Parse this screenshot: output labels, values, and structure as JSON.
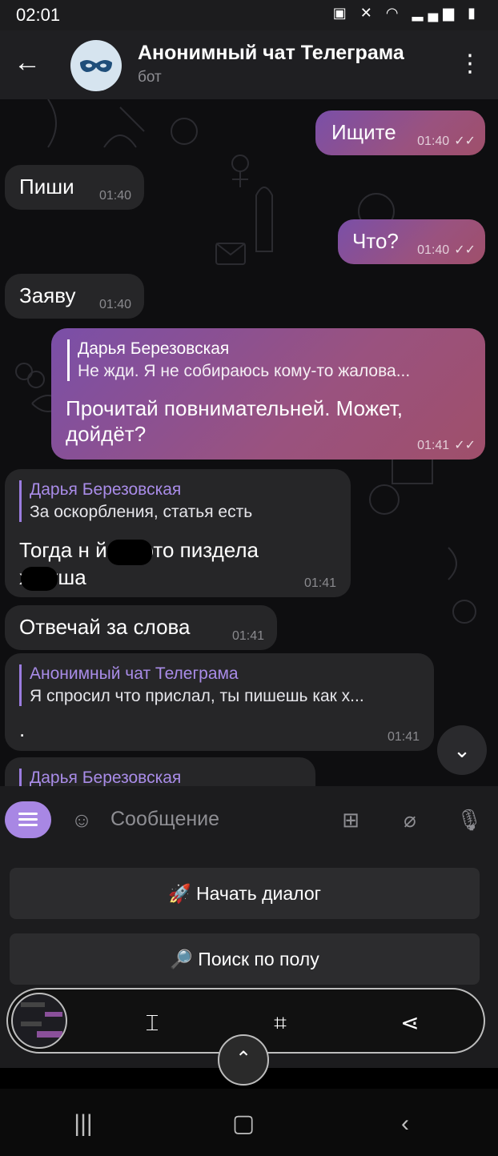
{
  "status_bar": {
    "time": "02:01",
    "icons": [
      "battery-saver-icon",
      "mute-icon",
      "wifi-icon",
      "signal-icon",
      "battery-icon"
    ]
  },
  "header": {
    "title": "Анонимный чат Телеграма",
    "subtitle": "бот",
    "avatar_icon": "mask-icon"
  },
  "messages": [
    {
      "direction": "out",
      "text": "Ищите",
      "time": "01:40",
      "read": true
    },
    {
      "direction": "in",
      "text": "Пиши",
      "time": "01:40"
    },
    {
      "direction": "out",
      "text": "Что?",
      "time": "01:40",
      "read": true
    },
    {
      "direction": "in",
      "text": "Заяву",
      "time": "01:40"
    },
    {
      "direction": "out",
      "reply": {
        "name": "Дарья Березовская",
        "text": "Не жди. Я не собираюсь кому-то жалова..."
      },
      "text_lines": [
        "Прочитай повнимательней. Может,",
        "дойдёт?"
      ],
      "time": "01:41",
      "read": true
    },
    {
      "direction": "in",
      "reply": {
        "name": "Дарья Березовская",
        "text": "За оскорбления, статья есть"
      },
      "text_lines": [
        "Тогда н      й ты это пиздела",
        "х   луша"
      ],
      "time": "01:41"
    },
    {
      "direction": "in",
      "text": "Отвечай за слова",
      "time": "01:41"
    },
    {
      "direction": "in",
      "reply": {
        "name": "Анонимный чат Телеграма",
        "text": "Я спросил что прислал, ты пишешь как х..."
      },
      "text": ".",
      "time": "01:41"
    },
    {
      "direction": "in",
      "reply": {
        "name": "Дарья Березовская"
      }
    }
  ],
  "composer": {
    "placeholder": "Сообщение",
    "icons": [
      "bot-menu-icon",
      "sticker-icon",
      "keyboard-toggle-icon",
      "attach-icon",
      "mic-icon"
    ]
  },
  "bot_keyboard": {
    "buttons": [
      "🚀 Начать диалог",
      "🔎 Поиск по полу"
    ]
  },
  "capture_toolbar": {
    "tools": [
      "scroll-capture-icon",
      "crop-edit-icon",
      "share-icon"
    ]
  },
  "nav_bar": {
    "buttons": [
      "recents-icon",
      "home-icon",
      "back-icon"
    ]
  },
  "colors": {
    "outgoing_bubble": "#8a509a",
    "incoming_bubble": "#262628",
    "accent": "#a887e4",
    "reply_name": "#a98ce8"
  }
}
